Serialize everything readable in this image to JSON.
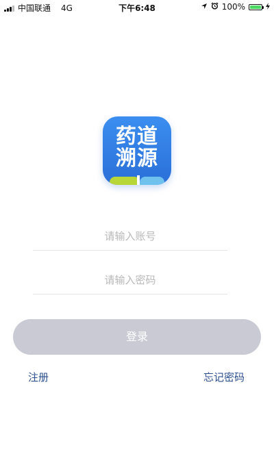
{
  "status_bar": {
    "carrier": "中国联通",
    "network": "4G",
    "time": "下午6:48",
    "battery_percent": "100%",
    "battery_level": 1.0,
    "icons": [
      "signal-icon",
      "location-icon",
      "alarm-icon",
      "battery-icon",
      "charging-icon"
    ]
  },
  "app_logo": {
    "line1": "药道",
    "line2": "溯源"
  },
  "form": {
    "account_placeholder": "请输入账号",
    "account_value": "",
    "password_placeholder": "请输入密码",
    "password_value": ""
  },
  "login_button": {
    "label": "登录"
  },
  "links": {
    "register": "注册",
    "forgot_password": "忘记密码"
  },
  "colors": {
    "logo_blue": "#2a6fd8",
    "logo_green": "#b8d637",
    "logo_light_blue": "#6fc1ee",
    "button_disabled": "#c9cad3",
    "link_blue": "#2c4f8f",
    "battery_green": "#4cd964"
  }
}
